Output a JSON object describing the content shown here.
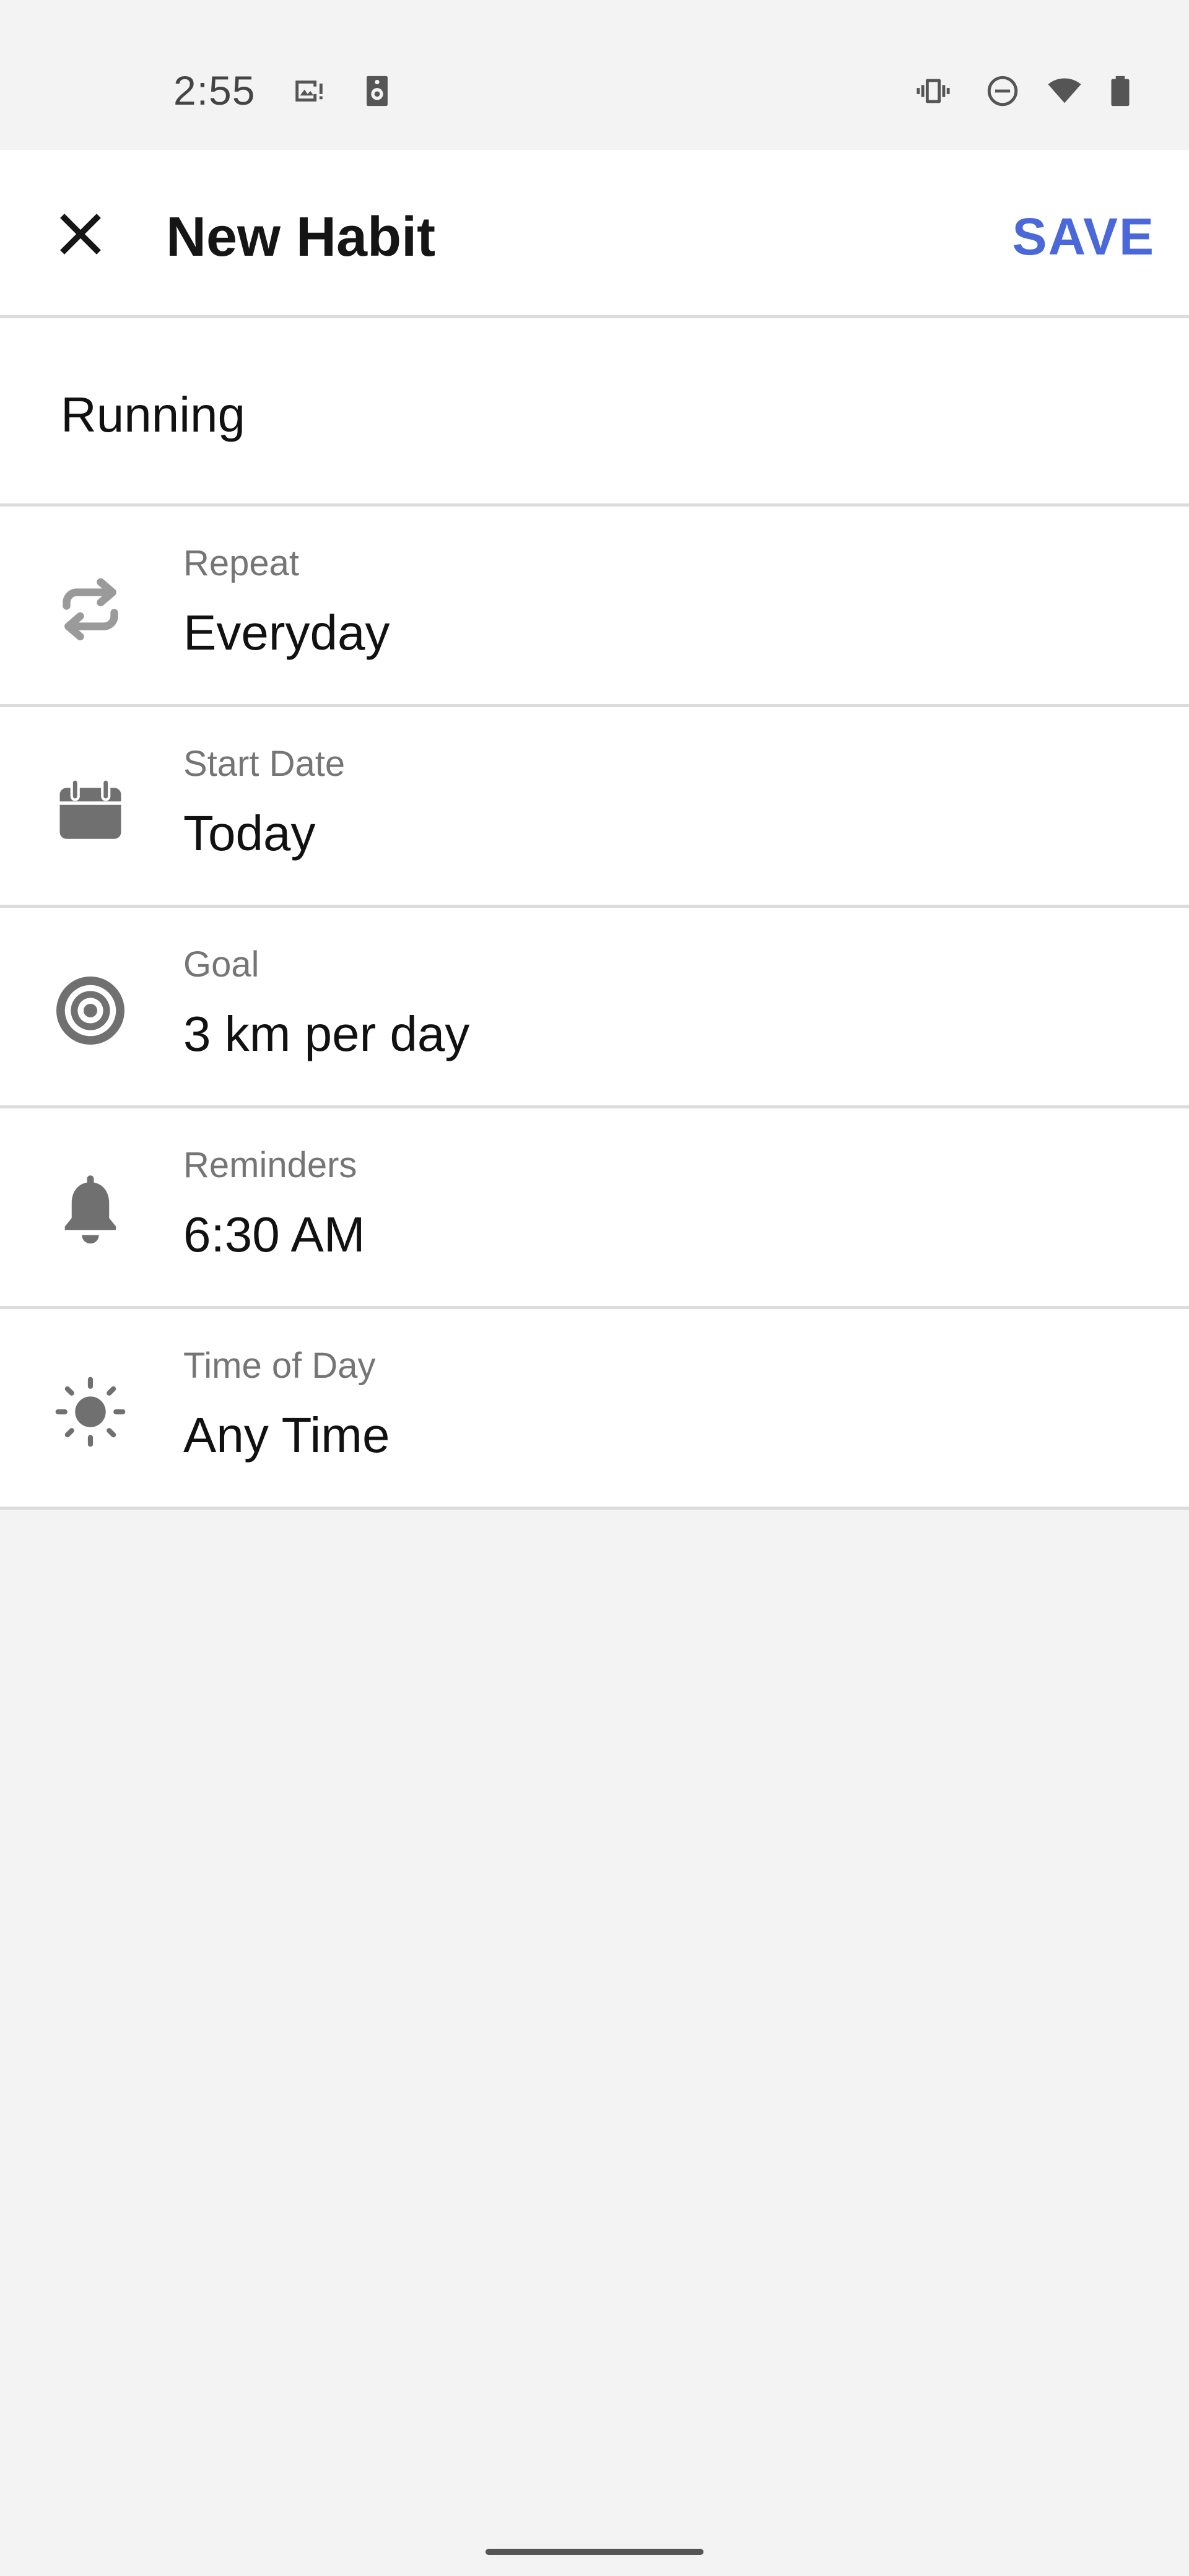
{
  "status_bar": {
    "time": "2:55",
    "icons": [
      "image-alert-icon",
      "speaker-icon",
      "vibrate-icon",
      "do-not-disturb-icon",
      "wifi-icon",
      "battery-icon"
    ]
  },
  "app_bar": {
    "title": "New Habit",
    "save_label": "SAVE",
    "close_icon": "close-icon"
  },
  "habit_name": {
    "value": "Running"
  },
  "settings": {
    "repeat": {
      "label": "Repeat",
      "value": "Everyday",
      "icon": "repeat-icon"
    },
    "start_date": {
      "label": "Start Date",
      "value": "Today",
      "icon": "calendar-icon"
    },
    "goal": {
      "label": "Goal",
      "value": "3 km per day",
      "icon": "target-icon"
    },
    "reminders": {
      "label": "Reminders",
      "value": "6:30 AM",
      "icon": "bell-icon"
    },
    "time_of_day": {
      "label": "Time of Day",
      "value": "Any Time",
      "icon": "sun-icon"
    }
  },
  "colors": {
    "accent": "#4a68da",
    "icon_gray": "#707070",
    "background": "#f3f3f3",
    "surface": "#ffffff",
    "divider": "#dcdcdc"
  }
}
